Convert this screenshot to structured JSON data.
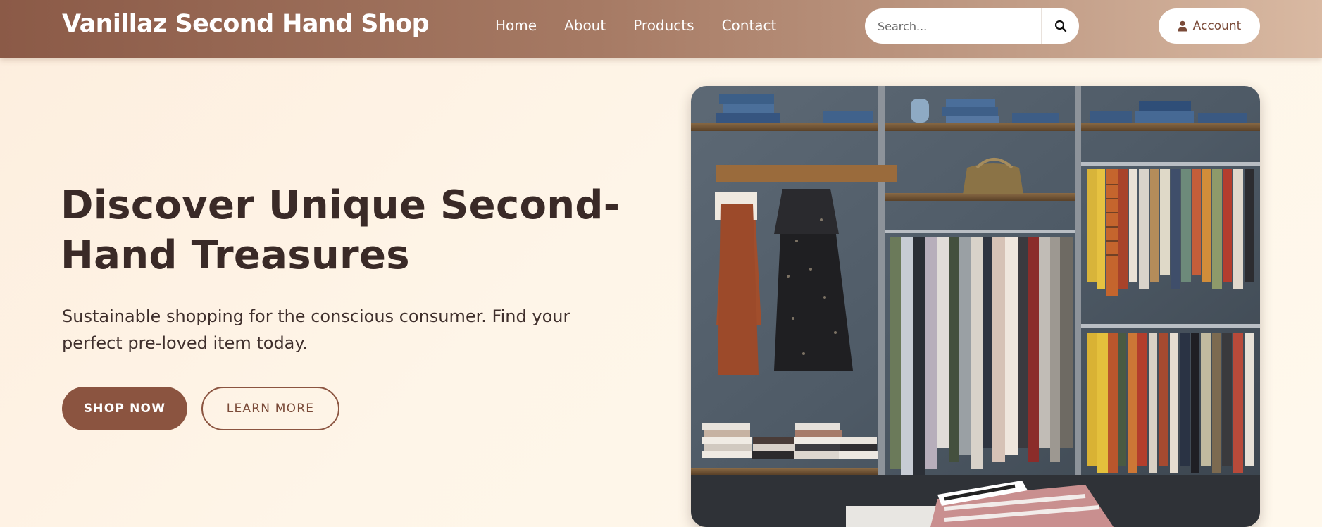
{
  "header": {
    "brand": "Vanillaz Second Hand Shop",
    "nav": [
      {
        "label": "Home"
      },
      {
        "label": "About"
      },
      {
        "label": "Products"
      },
      {
        "label": "Contact"
      }
    ],
    "search": {
      "placeholder": "Search...",
      "icon": "search-icon"
    },
    "account": {
      "label": "Account",
      "icon": "user-icon"
    }
  },
  "hero": {
    "title": "Discover Unique Second-Hand Treasures",
    "subtitle": "Sustainable shopping for the conscious consumer. Find your perfect pre-loved item today.",
    "primary_cta": "SHOP NOW",
    "secondary_cta": "LEARN MORE",
    "image": {
      "description_icon": "clothing-rack-photo"
    }
  },
  "colors": {
    "header_start": "#8b5a47",
    "header_end": "#d9b9a2",
    "accent": "#8b5440",
    "text_dark": "#3a2a27",
    "background": "#fef5e8"
  }
}
